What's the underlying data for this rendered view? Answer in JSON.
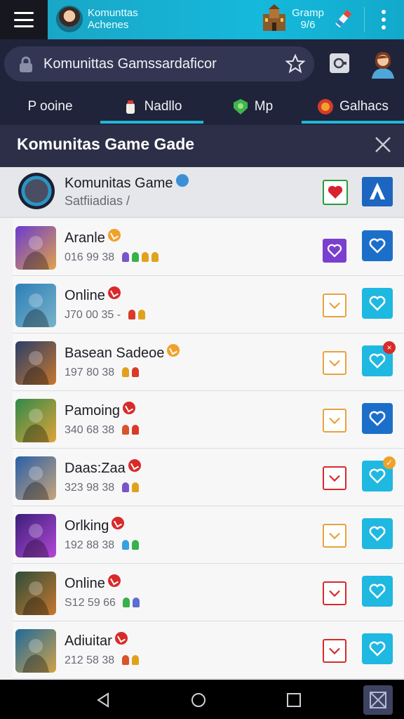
{
  "topbar": {
    "user_line1": "Komunttas",
    "user_line2": "Achenes",
    "stat_line1": "Gramp",
    "stat_line2": "9/6"
  },
  "search": {
    "value": "Komunittas Gamssardaficor"
  },
  "tabs": [
    {
      "label": "P ooine",
      "icon": "",
      "active": false
    },
    {
      "label": "Nadllo",
      "icon": "jar-icon",
      "active": true
    },
    {
      "label": "Mp",
      "icon": "map-shield-icon",
      "active": false
    },
    {
      "label": "Galhacs",
      "icon": "galaxy-badge-icon",
      "active": true
    }
  ],
  "section": {
    "title": "Komunitas Game Gade"
  },
  "featured": {
    "title": "Komunitas Game",
    "subtitle": "Satfiiadias /"
  },
  "games": [
    {
      "title": "Aranle",
      "stats": "016  99  38",
      "badge_color": "#f0a12a",
      "icon_colors": [
        "#6a3bd1",
        "#e0a24a"
      ],
      "minis": [
        "#7a55c9",
        "#38b14a",
        "#e2a11b",
        "#e0a21f"
      ],
      "chev_color": "#7b3fd0",
      "chev_fill": "#7b3fd0",
      "btn_color": "#1c6fc9",
      "badge": null
    },
    {
      "title": "Online",
      "stats": "J70  00  35  -",
      "badge_color": "#d92a2a",
      "icon_colors": [
        "#2d7fb8",
        "#79b3c8"
      ],
      "minis": [
        "#d93a2a",
        "#e2a11b"
      ],
      "chev_color": "#e9a23b",
      "chev_fill": "#ffffff",
      "btn_color": "#1fb8e0",
      "badge": null
    },
    {
      "title": "Basean Sadeoe",
      "stats": "197  80  38",
      "badge_color": "#f0a12a",
      "icon_colors": [
        "#2a3f68",
        "#c7772f"
      ],
      "minis": [
        "#e2a11b",
        "#d93a2a"
      ],
      "chev_color": "#e9a23b",
      "chev_fill": "#ffffff",
      "btn_color": "#1fb8e0",
      "badge": {
        "color": "#d92a2a",
        "text": "×"
      }
    },
    {
      "title": "Pamoing",
      "stats": "340  68  38",
      "badge_color": "#d92a2a",
      "icon_colors": [
        "#2f8a4a",
        "#e1a339"
      ],
      "minis": [
        "#d9542a",
        "#d93a2a"
      ],
      "chev_color": "#e9a23b",
      "chev_fill": "#ffffff",
      "btn_color": "#1c6fc9",
      "badge": null
    },
    {
      "title": "Daas:Zaa",
      "stats": "323  98  38",
      "badge_color": "#d92a2a",
      "icon_colors": [
        "#2860a8",
        "#c9a47a"
      ],
      "minis": [
        "#7a55c9",
        "#e2a11b"
      ],
      "chev_color": "#d92a2a",
      "chev_fill": "#ffffff",
      "btn_color": "#1fb8e0",
      "badge": {
        "color": "#f0a12a",
        "text": "✓"
      }
    },
    {
      "title": "Orlking",
      "stats": "192  88  38",
      "badge_color": "#d92a2a",
      "icon_colors": [
        "#3a1f78",
        "#b447d8"
      ],
      "minis": [
        "#38a0e0",
        "#38b14a"
      ],
      "chev_color": "#e9a23b",
      "chev_fill": "#ffffff",
      "btn_color": "#1fb8e0",
      "badge": null
    },
    {
      "title": "Online",
      "stats": "S12  59  66",
      "badge_color": "#d92a2a",
      "icon_colors": [
        "#2d4e3a",
        "#c7772f"
      ],
      "minis": [
        "#38b14a",
        "#5a6fd0"
      ],
      "chev_color": "#d92a2a",
      "chev_fill": "#ffffff",
      "btn_color": "#1fb8e0",
      "badge": null
    },
    {
      "title": "Adiuitar",
      "stats": "212  58  38",
      "badge_color": "#d92a2a",
      "icon_colors": [
        "#1f6a9a",
        "#d1a14a"
      ],
      "minis": [
        "#d9542a",
        "#e2a11b"
      ],
      "chev_color": "#d92a2a",
      "chev_fill": "#ffffff",
      "btn_color": "#1fb8e0",
      "badge": null
    }
  ]
}
